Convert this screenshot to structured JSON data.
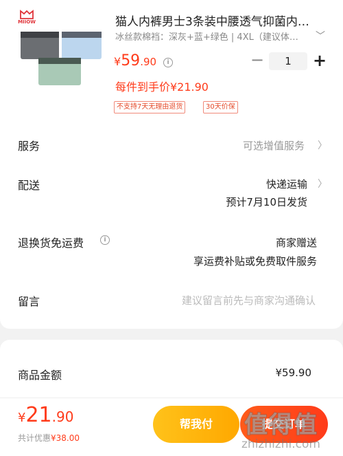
{
  "product": {
    "brand": "MIIOW",
    "title": "猫人内裤男士3条装中腰透气抑菌内…",
    "spec": "冰丝款棉裆：深灰+蓝+绿色 | 4XL（建议体…",
    "price_currency": "¥",
    "price_int": "59",
    "price_dec": ".90",
    "quantity": "1",
    "minus": "−",
    "plus": "+",
    "per_piece": "每件到手价¥21.90",
    "tags": [
      "不支持7天无理由退货",
      "30天价保"
    ],
    "colors": [
      "#6b6e72",
      "#bcd6ee",
      "#a9c9b6"
    ]
  },
  "rows": {
    "service": {
      "label": "服务",
      "value": "可选增值服务"
    },
    "delivery": {
      "label": "配送",
      "value": "快递运输",
      "sub": "预计7月10日发货"
    },
    "return_shipping": {
      "label": "退换货免运费",
      "value": "商家赠送",
      "sub": "享运费补贴或免费取件服务"
    },
    "message": {
      "label": "留言",
      "placeholder": "建议留言前先与商家沟通确认"
    }
  },
  "summary": {
    "goods_amount_label": "商品金额",
    "goods_amount_value": "¥59.90"
  },
  "footer": {
    "total_currency": "¥",
    "total_int": "21",
    "total_dec": ".90",
    "saving_prefix": "共计优惠",
    "saving_amount": "¥38.00",
    "help_pay_label": "帮我付",
    "pay_label": "提交订单",
    "watermark": "值得值",
    "watermark_url": "zhizhizhi.com"
  },
  "colors": {
    "accent": "#ff3b1a",
    "help_button": "#ffb20a"
  }
}
